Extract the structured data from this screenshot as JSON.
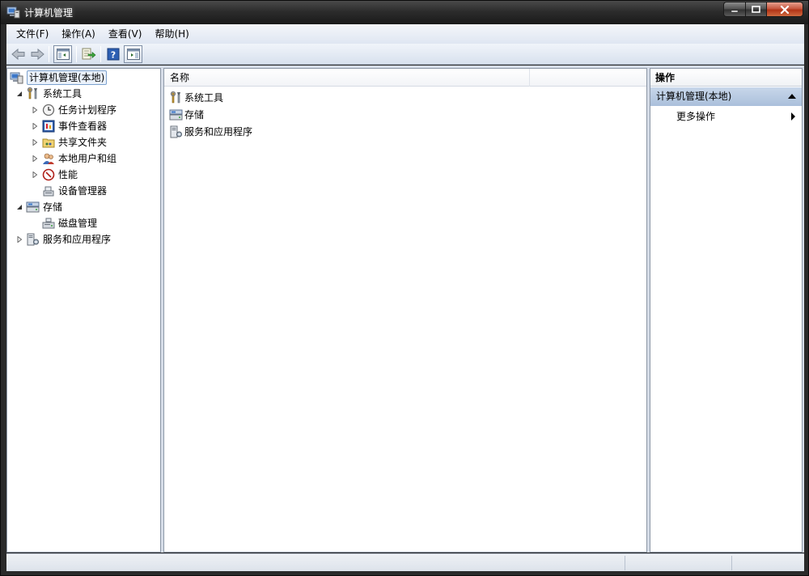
{
  "window": {
    "title": "计算机管理"
  },
  "menu": [
    {
      "label": "文件(F)"
    },
    {
      "label": "操作(A)"
    },
    {
      "label": "查看(V)"
    },
    {
      "label": "帮助(H)"
    }
  ],
  "toolbar": {
    "buttons": [
      "back-icon",
      "forward-icon",
      "show-hide-console-tree-icon",
      "export-list-icon",
      "help-icon",
      "show-hide-action-pane-icon"
    ]
  },
  "tree": {
    "root": "计算机管理(本地)",
    "system_tools": "系统工具",
    "task_scheduler": "任务计划程序",
    "event_viewer": "事件查看器",
    "shared_folders": "共享文件夹",
    "local_users": "本地用户和组",
    "performance": "性能",
    "device_manager": "设备管理器",
    "storage": "存储",
    "disk_management": "磁盘管理",
    "services_apps": "服务和应用程序"
  },
  "list": {
    "column_name": "名称",
    "rows": [
      {
        "label": "系统工具"
      },
      {
        "label": "存储"
      },
      {
        "label": "服务和应用程序"
      }
    ]
  },
  "actions": {
    "header": "操作",
    "section": "计算机管理(本地)",
    "more": "更多操作"
  },
  "colors": {
    "selection_border": "#7da2ce",
    "section_blue": "#aabfdb",
    "menu_bg": "#dfe6f2"
  }
}
